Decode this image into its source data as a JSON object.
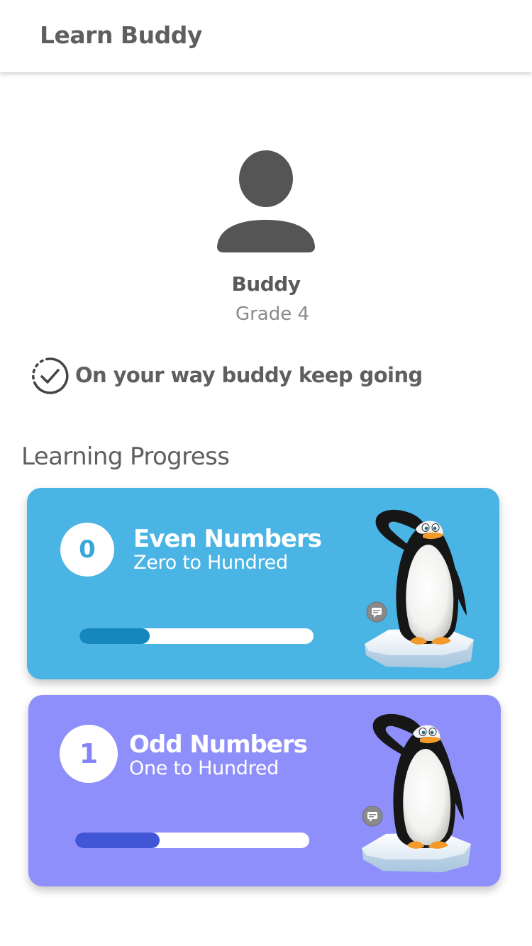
{
  "app": {
    "title": "Learn Buddy"
  },
  "profile": {
    "avatar_icon": "person-icon",
    "name": "Buddy",
    "grade": "Grade 4"
  },
  "status": {
    "icon": "progress-check-icon",
    "text": "On your way buddy keep going"
  },
  "section": {
    "title": "Learning Progress"
  },
  "cards": [
    {
      "badge": "0",
      "title": "Even Numbers",
      "subtitle": "Zero to Hundred",
      "progress": 0.3,
      "bg_color": "#4ab4e4",
      "bar_color": "#1687bd",
      "badge_color": "#3aa6dc",
      "illustration": "penguin-on-ice-illustration",
      "chat_icon": "chat-bubble-icon"
    },
    {
      "badge": "1",
      "title": "Odd Numbers",
      "subtitle": "One to Hundred",
      "progress": 0.36,
      "bg_color": "#8f8ffc",
      "bar_color": "#4156d6",
      "badge_color": "#8585f8",
      "illustration": "penguin-on-ice-illustration",
      "chat_icon": "chat-bubble-icon"
    }
  ]
}
